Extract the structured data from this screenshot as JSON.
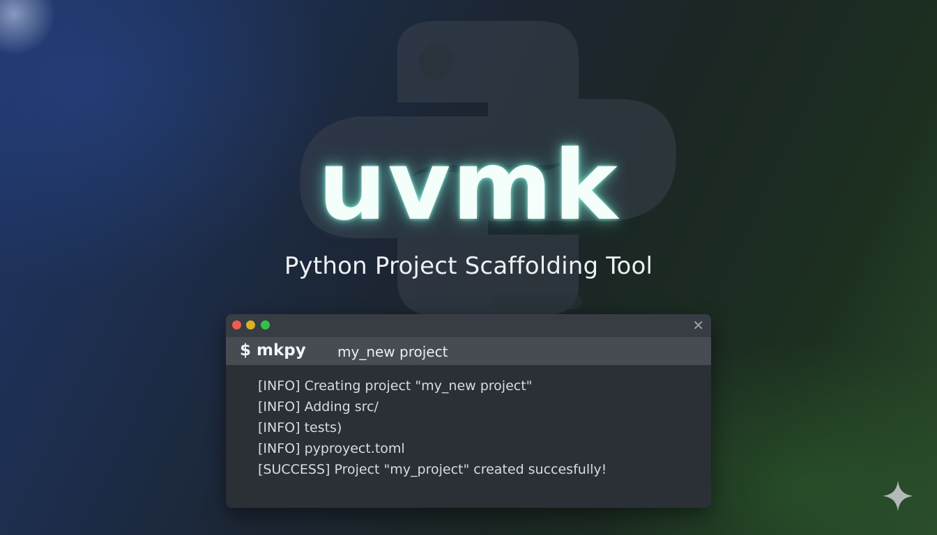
{
  "app": {
    "title": "uvmk",
    "subtitle": "Python Project Scaffolding Tool"
  },
  "terminal": {
    "window_controls": [
      "close",
      "minimize",
      "maximize"
    ],
    "close_symbol": "✕",
    "prompt": "$ mkpy",
    "argument": "my_new project",
    "output_lines": [
      "[INFO] Creating project \"my_new project\"",
      "[INFO] Adding src/",
      "[INFO] tests)",
      "[INFO] pyproyect.toml",
      "[SUCCESS] Project \"my_project\" created succesfully!"
    ]
  },
  "icons": {
    "background_logo": "python-logo-icon",
    "corner_mark": "sparkle-icon"
  },
  "colors": {
    "title_glow": "#7ff0d8",
    "traffic_red": "#f05b53",
    "traffic_yellow": "#d9b125",
    "traffic_green": "#33c048",
    "terminal_bg": "#2b2f36"
  }
}
